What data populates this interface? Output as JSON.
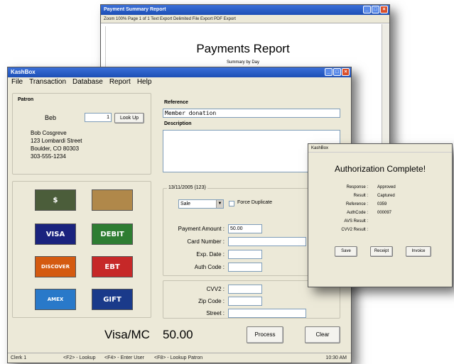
{
  "report_window": {
    "title": "Payment Summary Report",
    "toolbar_text": "Zoom 100%    Page 1 of 1    Text Export  Delimited File Export  PDF Export",
    "heading": "Payments Report",
    "subheading": "Summary by Day"
  },
  "kashbox": {
    "title": "KashBox",
    "menu": [
      "File",
      "Transaction",
      "Database",
      "Report",
      "Help"
    ],
    "patron": {
      "section_label": "Patron",
      "name_label": "Beb",
      "id_value": "1",
      "lookup_button": "Look Up",
      "address_lines": [
        "Bob Cosgreve",
        "123 Lombardi Street",
        "Boulder, CO 80303",
        "303-555-1234"
      ]
    },
    "cards": [
      {
        "name": "cash",
        "label": "$",
        "color": "#4b5d3a"
      },
      {
        "name": "check",
        "label": "",
        "color": "#b0884a"
      },
      {
        "name": "visa",
        "label": "VISA",
        "color": "#1a237e"
      },
      {
        "name": "debit",
        "label": "DEBIT",
        "color": "#2e7d32"
      },
      {
        "name": "discover",
        "label": "DISCOVER",
        "color": "#d45a10"
      },
      {
        "name": "ebt",
        "label": "EBT",
        "color": "#c62828"
      },
      {
        "name": "amex",
        "label": "AMEX",
        "color": "#2979c9"
      },
      {
        "name": "gift",
        "label": "GIFT",
        "color": "#1a3a8a"
      }
    ],
    "reference": {
      "label": "Reference",
      "value": "Member donation"
    },
    "description": {
      "label": "Description",
      "value": ""
    },
    "transaction": {
      "group_label": "13/11/2005 (123)",
      "type_value": "Sale",
      "force_duplicate_label": "Force Duplicate",
      "payment_amount_label": "Payment Amount :",
      "payment_amount_value": "50.00",
      "card_number_label": "Card Number :",
      "exp_date_label": "Exp. Date :",
      "auth_code_label": "Auth Code :",
      "cvv2_label": "CVV2 :",
      "zip_label": "Zip Code :",
      "street_label": "Street :"
    },
    "summary": {
      "method": "Visa/MC",
      "amount": "50.00"
    },
    "process_button": "Process",
    "clear_button": "Clear",
    "status": {
      "clerk": "Clerk 1",
      "hint1": "<F2> - Lookup",
      "hint2": "<F4> - Enter User",
      "hint3": "<F8> - Lookup Patron",
      "time": "10:30 AM"
    }
  },
  "auth_window": {
    "title": "KashBox",
    "heading": "Authorization Complete!",
    "rows": [
      {
        "key": "Response :",
        "value": "Approved"
      },
      {
        "key": "Result :",
        "value": "Captured"
      },
      {
        "key": "Reference :",
        "value": "0359"
      },
      {
        "key": "AuthCode :",
        "value": "000097"
      },
      {
        "key": "AVS Result :",
        "value": ""
      },
      {
        "key": "CVV2 Result :",
        "value": ""
      }
    ],
    "save_button": "Save",
    "receipt_button": "Receipt",
    "invoice_button": "Invoice"
  },
  "colors": {
    "titlebar": "#1d4fb5",
    "window_face": "#ece9d8",
    "field_border": "#7f9db9"
  }
}
